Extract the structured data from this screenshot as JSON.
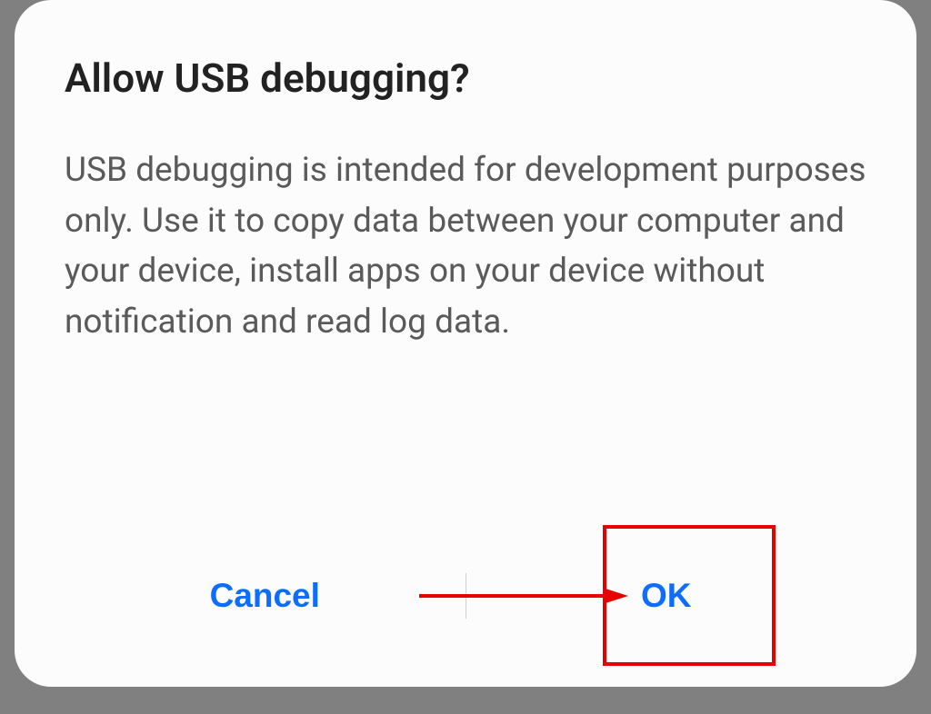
{
  "dialog": {
    "title": "Allow USB debugging?",
    "message": "USB debugging is intended for development purposes only. Use it to copy data between your computer and your device, install apps on your device without notification and read log data.",
    "cancel_label": "Cancel",
    "ok_label": "OK"
  }
}
